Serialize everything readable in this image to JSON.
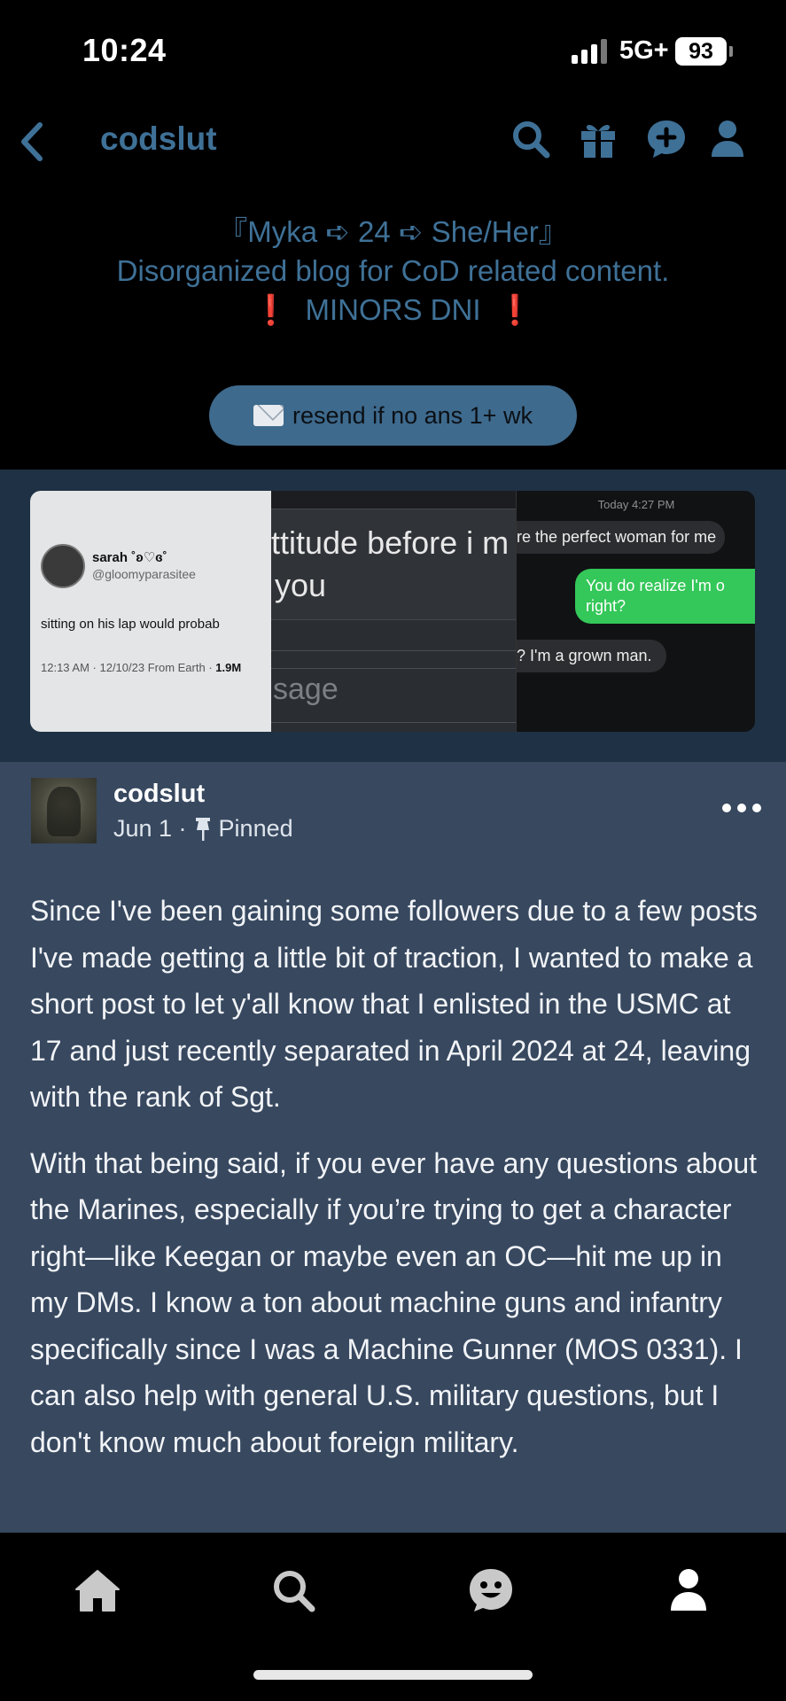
{
  "status_bar": {
    "time": "10:24",
    "network": "5G+",
    "battery": "93"
  },
  "header": {
    "blog_name": "codslut",
    "icons": [
      "back-chevron-icon",
      "search-icon",
      "gift-icon",
      "new-message-icon",
      "account-icon"
    ],
    "accent_color": "#3f7197"
  },
  "description": {
    "line1": "『Myka ➪ 24 ➪ She/Her』",
    "line2": "Disorganized blog for CoD related content.",
    "line3_excl": "❗",
    "line3_text": "MINORS DNI"
  },
  "ask_button": {
    "label": "resend if no ans 1+ wk",
    "icon": "envelope-icon"
  },
  "media": {
    "tweet": {
      "name": "sarah ˚ʚ♡ɞ˚",
      "handle": "@gloomyparasitee",
      "text": "sitting on his lap would probab",
      "meta_prefix": "12:13 AM · 12/10/23 From Earth · ",
      "meta_bold": "1.9M"
    },
    "chat": {
      "line1": "ttitude before i m",
      "line2": "you",
      "placeholder": "sage"
    },
    "sms": {
      "time": "Today 4:27 PM",
      "received1": "re the perfect woman for me",
      "sent": "You do realize I'm o right?",
      "received2": "? I'm a grown man."
    }
  },
  "post": {
    "author": "codslut",
    "date": "Jun 1 ·",
    "pinned_label": "Pinned",
    "paragraphs": [
      "Since I've been gaining some followers due to a few posts I've made getting a little bit of traction, I wanted to make a short post to let y'all know that I enlisted in the USMC at 17 and just recently separated in April 2024 at 24, leaving with the rank of Sgt.",
      "With that being said, if you ever have any questions about the Marines, especially if you’re trying to get a character right—like Keegan or maybe even an OC—hit me up in my DMs. I know a ton about machine guns and infantry specifically since I was a Machine Gunner (MOS 0331). I can also help with general U.S. military questions, but I don't know much about foreign military."
    ]
  },
  "bottom_nav": {
    "items": [
      "home-icon",
      "search-icon",
      "activity-face-icon",
      "account-icon"
    ]
  }
}
